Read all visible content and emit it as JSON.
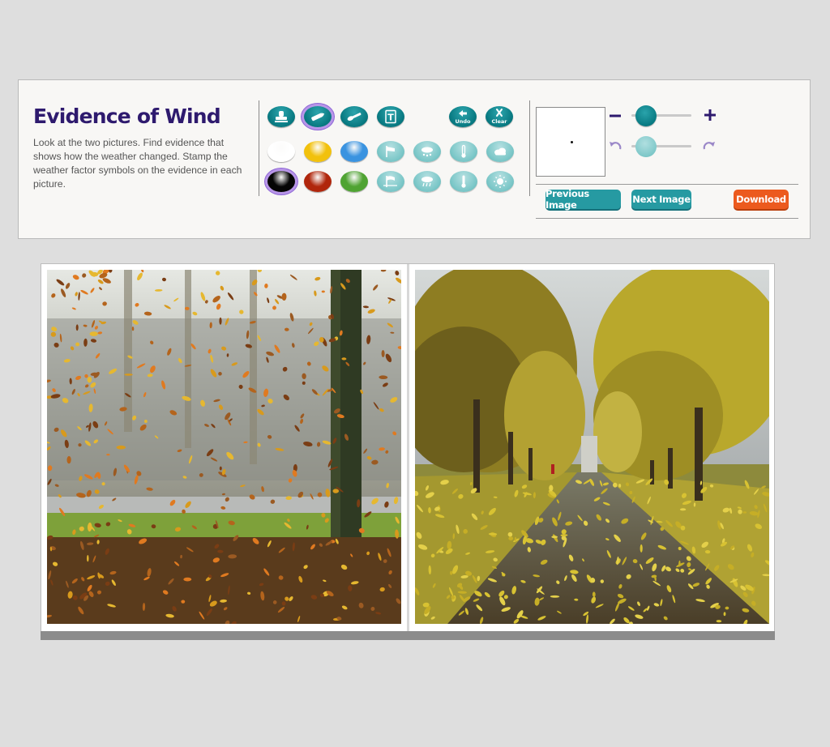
{
  "activity": {
    "title": "Evidence of Wind",
    "instructions": "Look at the two pictures. Find evidence that shows how the weather changed. Stamp the weather factor symbols on the evidence in each picture."
  },
  "tools": {
    "top_row": [
      {
        "icon": "stamp-icon",
        "selected": false
      },
      {
        "icon": "marker-icon",
        "selected": true
      },
      {
        "icon": "brush-icon",
        "selected": false
      },
      {
        "icon": "text-tool-icon",
        "selected": false
      }
    ],
    "undo_label": "Undo",
    "clear_label": "Clear",
    "colors": [
      {
        "name": "white",
        "hex": "#ffffff"
      },
      {
        "name": "yellow",
        "hex": "#f2c10c"
      },
      {
        "name": "blue",
        "hex": "#3a93e0"
      },
      {
        "name": "black",
        "hex": "#050505"
      },
      {
        "name": "red",
        "hex": "#b0260c"
      },
      {
        "name": "green",
        "hex": "#4fa332"
      }
    ],
    "selected_color": "black",
    "weather_stamps_row1": [
      "wind-sock-icon",
      "snow-cloud-icon",
      "thermometer-low-icon",
      "cloud-icon"
    ],
    "weather_stamps_row2": [
      "flag-wind-icon",
      "rain-cloud-icon",
      "thermometer-high-icon",
      "sun-icon"
    ]
  },
  "controls": {
    "size_level": 0.1,
    "opacity_level": 0.1,
    "previous_label": "Previous Image",
    "next_label": "Next Image",
    "download_label": "Download"
  },
  "colors": {
    "accent_teal": "#269aa2",
    "download_orange": "#ec5a1e",
    "title_purple": "#2e1a6e"
  }
}
